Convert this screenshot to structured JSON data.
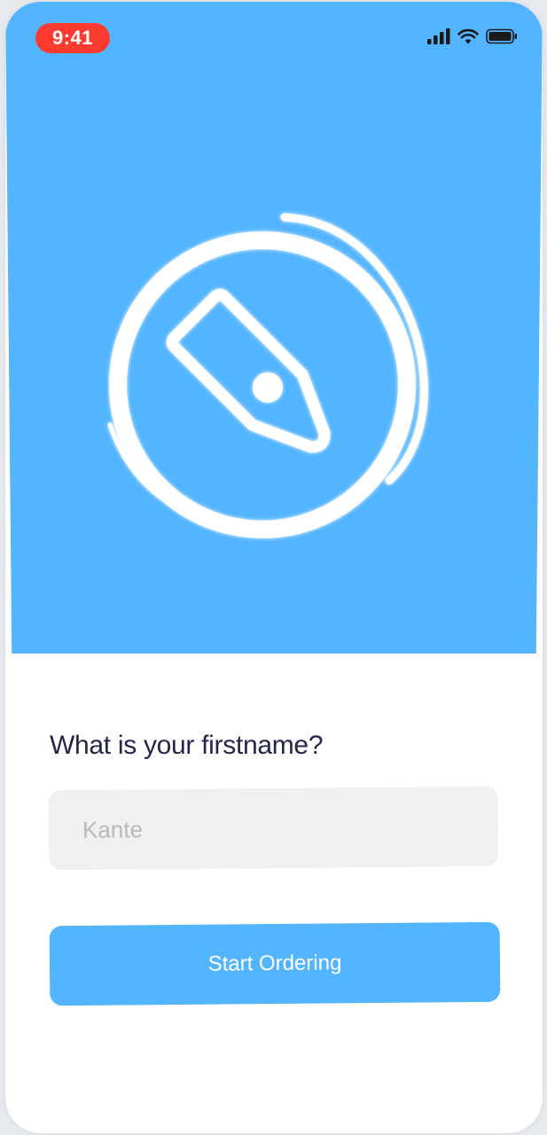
{
  "status_bar": {
    "time": "9:41",
    "icons": [
      "cellular-signal-icon",
      "wifi-icon",
      "battery-icon"
    ]
  },
  "hero": {
    "logo_icon": "price-tag-icon"
  },
  "form": {
    "question": "What is your firstname?",
    "name_placeholder": "Kante",
    "name_value": "",
    "submit_label": "Start Ordering"
  },
  "colors": {
    "accent": "#53b4ff",
    "time_pill": "#ff3b30",
    "heading_text": "#23254a",
    "input_background": "#f0f0f0",
    "placeholder_text": "#b8b8b8"
  }
}
